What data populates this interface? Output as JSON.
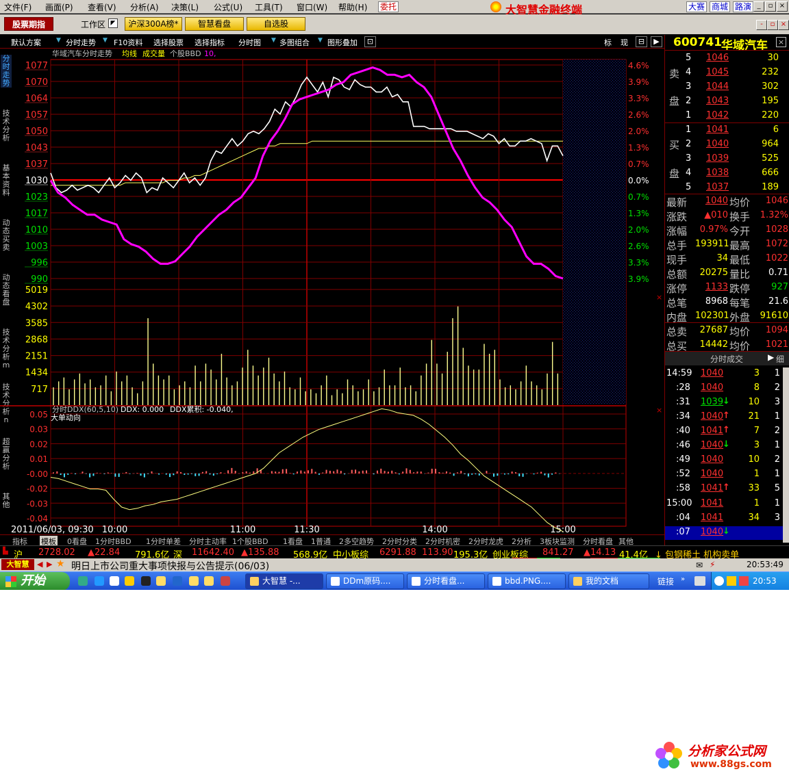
{
  "menu": [
    "文件(F)",
    "画面(P)",
    "查看(V)",
    "分析(A)",
    "决策(L)",
    "公式(U)",
    "工具(T)",
    "窗口(W)",
    "帮助(H)"
  ],
  "weituo": "委托",
  "brand": "大智慧金融终端",
  "toplinks": [
    "大赛",
    "商城",
    "路演"
  ],
  "tabs": {
    "main": "股票期指",
    "workarea": "工作区",
    "yellow": [
      "沪深300A榜*",
      "智慧看盘",
      "自选股"
    ]
  },
  "toolbar": [
    "默认方案",
    "分时走势",
    "F10资料",
    "选择股票",
    "选择指标",
    "分时图",
    "多图组合",
    "图形叠加"
  ],
  "toolbar_right": [
    "标",
    "现"
  ],
  "left_tabs": [
    "分时走势",
    "技术分析",
    "基本资料",
    "动态买卖",
    "动态看盘",
    "技术分析m",
    "技术分析n",
    "超赢分析",
    "其他"
  ],
  "chart_header": {
    "title": "华域汽车分时走势",
    "avg": "均线",
    "vol": "成交量",
    "bbd_label": "个股BBD",
    "bbd_value": "10,",
    "ddx_label": "分时DDX(60,5,10)",
    "ddx_value": "DDX: 0.000",
    "ddx_sum": "DDX累积: -0.040,",
    "big_order": "大单动向"
  },
  "chart_data": {
    "type": "line",
    "price_ticks": [
      "1077",
      "1070",
      "1064",
      "1057",
      "1050",
      "1043",
      "1037",
      "1030",
      "1023",
      "1017",
      "1010",
      "1003",
      "996",
      "990"
    ],
    "pct_ticks": [
      "4.6%",
      "3.9%",
      "3.3%",
      "2.6%",
      "2.0%",
      "1.3%",
      "0.7%",
      "0.0%",
      "0.7%",
      "1.3%",
      "2.0%",
      "2.6%",
      "3.3%",
      "3.9%"
    ],
    "vol_ticks": [
      "5019",
      "4302",
      "3585",
      "2868",
      "2151",
      "1434",
      "717"
    ],
    "ddx_ticks": [
      "0.05",
      "0.03",
      "0.02",
      "0.01",
      "-0.00",
      "-0.02",
      "-0.03",
      "-0.04"
    ],
    "time_labels": [
      "2011/06/03, 09:30",
      "10:00",
      "11:00",
      "11:30",
      "14:00",
      "15:00"
    ],
    "prev_close": 1030,
    "ylim": [
      990,
      1077
    ],
    "price": [
      1033,
      1027,
      1025,
      1026,
      1028,
      1026,
      1027,
      1028,
      1027,
      1025,
      1028,
      1031,
      1027,
      1029,
      1032,
      1030,
      1033,
      1031,
      1025,
      1027,
      1026,
      1031,
      1029,
      1027,
      1030,
      1033,
      1029,
      1031,
      1028,
      1031,
      1038,
      1042,
      1041,
      1044,
      1047,
      1044,
      1046,
      1049,
      1050,
      1049,
      1051,
      1054,
      1059,
      1057,
      1062,
      1060,
      1064,
      1069,
      1072,
      1069,
      1066,
      1070,
      1064,
      1072,
      1071,
      1068,
      1067,
      1071,
      1069,
      1068,
      1068,
      1066,
      1066,
      1068,
      1064,
      1065,
      1062,
      1062,
      1052,
      1052,
      1052,
      1051,
      1051,
      1051,
      1051,
      1051,
      1050,
      1050,
      1050,
      1049,
      1048,
      1047,
      1049,
      1048,
      1045,
      1047,
      1044,
      1044,
      1046,
      1046,
      1047,
      1046,
      1045,
      1038,
      1044,
      1044,
      1040
    ],
    "avg": [
      1028,
      1028,
      1028,
      1028,
      1028,
      1028,
      1028,
      1028,
      1028,
      1028,
      1028,
      1028,
      1028,
      1028,
      1029,
      1029,
      1029,
      1029,
      1029,
      1029,
      1029,
      1029,
      1030,
      1030,
      1030,
      1031,
      1031,
      1032,
      1032,
      1033,
      1034,
      1035,
      1036,
      1037,
      1038,
      1039,
      1040,
      1041,
      1042,
      1043,
      1043,
      1044,
      1044,
      1045,
      1045,
      1045,
      1045,
      1045,
      1045,
      1046,
      1046,
      1046,
      1046,
      1046,
      1046,
      1046,
      1046,
      1046,
      1046,
      1046,
      1046,
      1046,
      1046,
      1046,
      1046,
      1046,
      1046,
      1046,
      1046,
      1046,
      1046,
      1046,
      1046,
      1046,
      1046,
      1046,
      1046,
      1046,
      1046,
      1046,
      1046,
      1046,
      1046,
      1046,
      1046,
      1046,
      1046,
      1046,
      1046,
      1046,
      1046,
      1046,
      1046,
      1046,
      1046,
      1046,
      1046
    ],
    "bbd": [
      1030,
      1025,
      1023,
      1020,
      1018,
      1016,
      1016,
      1014,
      1013,
      1012,
      1006,
      1004,
      1003,
      1001,
      998,
      996,
      996,
      997,
      1000,
      1003,
      1007,
      1010,
      1013,
      1016,
      1018,
      1021,
      1023,
      1027,
      1031,
      1040,
      1046,
      1050,
      1055,
      1061,
      1063,
      1064,
      1065,
      1066,
      1067,
      1069,
      1070,
      1073,
      1074,
      1075,
      1076,
      1075,
      1073,
      1073,
      1072,
      1073,
      1070,
      1068,
      1064,
      1057,
      1050,
      1043,
      1038,
      1032,
      1027,
      1023,
      1021,
      1018,
      1014,
      1011,
      1005,
      999,
      996,
      996,
      994,
      991,
      990
    ],
    "volume": [
      900,
      1200,
      1400,
      800,
      1300,
      1600,
      1100,
      1300,
      900,
      1000,
      1500,
      700,
      1700,
      1200,
      1500,
      900,
      600,
      1200,
      4400,
      2100,
      1500,
      1300,
      1500,
      800,
      1000,
      1200,
      900,
      2000,
      1200,
      2100,
      1800,
      1300,
      2600,
      1400,
      1000,
      1200,
      1900,
      2800,
      2000,
      1500,
      1900,
      2400,
      1600,
      1200,
      1700,
      900,
      800,
      1400,
      700,
      800,
      600,
      1000,
      1500,
      500,
      800,
      600,
      1300,
      1000,
      700,
      800,
      1300,
      700,
      900,
      1800,
      1000,
      1000,
      1900,
      900,
      1000,
      700,
      1500,
      2100,
      3300,
      2100,
      1600,
      2700,
      4400,
      5000,
      2900,
      2000,
      1800,
      1800,
      3100,
      2600,
      2800,
      1300,
      900,
      1000,
      800,
      1200,
      2000,
      1200,
      1000,
      800,
      1600,
      3200,
      1600
    ],
    "ddx_cum": [
      -0.003,
      -0.004,
      -0.006,
      -0.008,
      -0.01,
      -0.012,
      -0.012,
      -0.013,
      -0.02,
      -0.026,
      -0.028,
      -0.027,
      -0.025,
      -0.024,
      -0.022,
      -0.021,
      -0.02,
      -0.018,
      -0.016,
      -0.014,
      -0.012,
      -0.01,
      -0.008,
      -0.006,
      -0.004,
      -0.002,
      0.0,
      0.004,
      0.01,
      0.016,
      0.02,
      0.024,
      0.028,
      0.031,
      0.034,
      0.036,
      0.038,
      0.04,
      0.042,
      0.044,
      0.046,
      0.048,
      0.05,
      0.049,
      0.047,
      0.046,
      0.045,
      0.042,
      0.038,
      0.033,
      0.028,
      0.022,
      0.015,
      0.01,
      0.004,
      -0.002,
      -0.006,
      -0.01,
      -0.014,
      -0.018,
      -0.022,
      -0.026,
      -0.032,
      -0.038,
      -0.042,
      -0.045
    ]
  },
  "stock": {
    "code": "600741",
    "name": "华域汽车"
  },
  "sell_label": [
    "卖",
    "盘"
  ],
  "buy_label": [
    "买",
    "盘"
  ],
  "sells": [
    [
      "5",
      "1046",
      "30"
    ],
    [
      "4",
      "1045",
      "232"
    ],
    [
      "3",
      "1044",
      "302"
    ],
    [
      "2",
      "1043",
      "195"
    ],
    [
      "1",
      "1042",
      "220"
    ]
  ],
  "buys": [
    [
      "1",
      "1041",
      "6"
    ],
    [
      "2",
      "1040",
      "964"
    ],
    [
      "3",
      "1039",
      "525"
    ],
    [
      "4",
      "1038",
      "666"
    ],
    [
      "5",
      "1037",
      "189"
    ]
  ],
  "stats": [
    [
      "最新",
      "1040",
      "均价",
      "1046"
    ],
    [
      "涨跌",
      "▲010",
      "换手",
      "1.32%"
    ],
    [
      "涨幅",
      "0.97%",
      "今开",
      "1028"
    ],
    [
      "总手",
      "193911",
      "最高",
      "1072"
    ],
    [
      "现手",
      "34",
      "最低",
      "1022"
    ],
    [
      "总额",
      "20275",
      "量比",
      "0.71"
    ],
    [
      "涨停",
      "1133",
      "跌停",
      "927"
    ],
    [
      "总笔",
      "8968",
      "每笔",
      "21.6"
    ],
    [
      "内盘",
      "102301",
      "外盘",
      "91610"
    ],
    [
      "总卖",
      "27687",
      "均价",
      "1094"
    ],
    [
      "总买",
      "14442",
      "均价",
      "1021"
    ]
  ],
  "ticks_header": {
    "title": "分时成交",
    "btn": "细"
  },
  "ticks": [
    [
      "14:59",
      "1040",
      "",
      "3",
      "1"
    ],
    [
      ":28",
      "1040",
      "",
      "8",
      "2"
    ],
    [
      ":31",
      "1039",
      "↓",
      "10",
      "3"
    ],
    [
      ":34",
      "1040",
      "↑",
      "21",
      "1"
    ],
    [
      ":40",
      "1041",
      "↑",
      "7",
      "2"
    ],
    [
      ":46",
      "1040",
      "↓",
      "3",
      "1"
    ],
    [
      ":49",
      "1040",
      "",
      "10",
      "2"
    ],
    [
      ":52",
      "1040",
      "",
      "1",
      "1"
    ],
    [
      ":58",
      "1041",
      "↑",
      "33",
      "5"
    ],
    [
      "15:00",
      "1041",
      "",
      "1",
      "1"
    ],
    [
      ":04",
      "1041",
      "",
      "34",
      "3"
    ],
    [
      ":07",
      "1040",
      "↓",
      "",
      ""
    ]
  ],
  "bottom_tabs": [
    "指标",
    "模板",
    "0看盘",
    "1分时BBD",
    "1分时单差",
    "分时主动率",
    "1个股BBD",
    "1看盘",
    "1普通",
    "2多空趋势",
    "2分时分类",
    "2分时机密",
    "2分时龙虎",
    "2分析",
    "3板块监测",
    "分时看盘",
    "其他"
  ],
  "index_bar": {
    "sh_label": "沪",
    "sh_value": "2728.02",
    "sh_change": "▲22.84",
    "sh_amount": "791.6亿",
    "sz_label": "深",
    "sz_value": "11642.40",
    "sz_change": "▲135.88",
    "sz_amount": "568.9亿",
    "zx_label": "中小板综",
    "zx_value": "6291.88",
    "zx_change": "113.90",
    "zx_amount": "195.3亿",
    "cy_label": "创业板综",
    "cy_value": "841.27",
    "cy_change": "▲14.13",
    "cy_amount": "41.4亿",
    "news": "↓ 包钢稀土 机构卖单"
  },
  "newsbar": {
    "logo": "大智慧",
    "text": "明日上市公司重大事项快报与公告提示(06/03)",
    "time": "20:53:49"
  },
  "taskbar": {
    "start": "开始",
    "tasks": [
      "大智慧 -...",
      "DDm原码....",
      "分时看盘...",
      "bbd.PNG....",
      "我的文档"
    ],
    "links": "链接",
    "time": "20:53"
  },
  "watermark": {
    "text": "分析家公式网",
    "url": "www.88gs.com"
  }
}
